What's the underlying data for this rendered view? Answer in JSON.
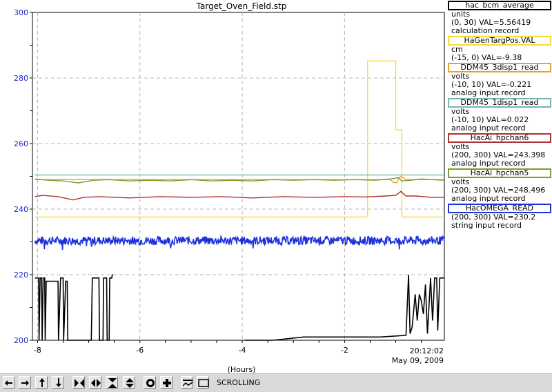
{
  "window": {
    "title": "Target_Oven_Field.stp"
  },
  "chart_data": {
    "type": "line",
    "title": "Target_Oven_Field.stp",
    "xlabel": "(Hours)",
    "ylabel": "",
    "xlim": [
      -8.1,
      -0.05
    ],
    "ylim": [
      200,
      300
    ],
    "x_ticks": [
      -8,
      -6,
      -4,
      -2
    ],
    "y_ticks": [
      200,
      220,
      240,
      260,
      280,
      300
    ],
    "grid": true,
    "end_time": "20:12:02",
    "end_date": "May 09, 2009",
    "series": [
      {
        "name": "hac_bcm_average",
        "color": "#000000",
        "units": "units",
        "range_val": "(0, 30) VAL=5.56419",
        "record": "calculation record",
        "points": [
          [
            -8.05,
            219
          ],
          [
            -7.98,
            219
          ],
          [
            -7.97,
            200
          ],
          [
            -7.95,
            219
          ],
          [
            -7.92,
            219
          ],
          [
            -7.91,
            200
          ],
          [
            -7.89,
            219
          ],
          [
            -7.86,
            219
          ],
          [
            -7.85,
            200
          ],
          [
            -7.83,
            218
          ],
          [
            -7.6,
            218
          ],
          [
            -7.59,
            200
          ],
          [
            -7.55,
            219
          ],
          [
            -7.5,
            219
          ],
          [
            -7.49,
            200
          ],
          [
            -7.45,
            218
          ],
          [
            -7.42,
            218
          ],
          [
            -7.41,
            200
          ],
          [
            -6.95,
            200
          ],
          [
            -6.93,
            219
          ],
          [
            -6.8,
            219
          ],
          [
            -6.79,
            200
          ],
          [
            -6.72,
            200
          ],
          [
            -6.71,
            219
          ],
          [
            -6.65,
            219
          ],
          [
            -6.64,
            200
          ],
          [
            -6.6,
            200
          ],
          [
            -6.59,
            219
          ],
          [
            -6.55,
            219
          ],
          [
            -6.54,
            220
          ],
          [
            -6.53,
            220
          ]
        ]
      },
      {
        "name": "hac_bcm_average",
        "color": "#000000",
        "units": "",
        "range_val": "",
        "record": "",
        "points": [
          [
            -3.95,
            200
          ],
          [
            -3.4,
            200
          ],
          [
            -2.8,
            201
          ],
          [
            -1.3,
            201
          ],
          [
            -0.8,
            201.5
          ],
          [
            -0.75,
            220
          ],
          [
            -0.72,
            202
          ],
          [
            -0.68,
            204
          ],
          [
            -0.62,
            214
          ],
          [
            -0.58,
            206
          ],
          [
            -0.54,
            214
          ],
          [
            -0.5,
            212
          ],
          [
            -0.46,
            208
          ],
          [
            -0.42,
            217
          ],
          [
            -0.38,
            202
          ],
          [
            -0.32,
            219
          ],
          [
            -0.28,
            206
          ],
          [
            -0.24,
            219
          ],
          [
            -0.2,
            219
          ],
          [
            -0.18,
            203
          ],
          [
            -0.14,
            219
          ],
          [
            -0.06,
            219
          ]
        ]
      },
      {
        "name": "HaGenTargPos.VAL",
        "color": "#f5dc3c",
        "units": "cm",
        "range_val": "(-15, 0) VAL=-9.38",
        "record": "",
        "points": [
          [
            -8.05,
            237.6
          ],
          [
            -1.55,
            237.6
          ],
          [
            -1.55,
            285.2
          ],
          [
            -1.0,
            285.2
          ],
          [
            -1.0,
            264.2
          ],
          [
            -0.88,
            264.2
          ],
          [
            -0.88,
            237.6
          ],
          [
            -0.05,
            237.6
          ]
        ]
      },
      {
        "name": "DDM45_3disp1_read",
        "color": "#f0a020",
        "units": "volts",
        "range_val": "(-10, 10) VAL=-0.221",
        "record": "analog input record",
        "points": [
          [
            -8.05,
            249.0
          ],
          [
            -7.0,
            249.0
          ],
          [
            -6.0,
            249.0
          ],
          [
            -4.0,
            249.0
          ],
          [
            -2.0,
            249.0
          ],
          [
            -1.1,
            249.0
          ],
          [
            -1.05,
            248.2
          ],
          [
            -0.98,
            248.0
          ],
          [
            -0.95,
            249.2
          ],
          [
            -0.9,
            250.0
          ],
          [
            -0.8,
            249.0
          ],
          [
            -0.05,
            249.0
          ]
        ]
      },
      {
        "name": "DDM45_1disp1_read",
        "color": "#78b4b4",
        "units": "volts",
        "range_val": "(-10, 10) VAL=0.022",
        "record": "analog input record",
        "points": [
          [
            -8.05,
            250.4
          ],
          [
            -0.05,
            250.4
          ]
        ]
      },
      {
        "name": "HacAi_hpchan6",
        "color": "#b03030",
        "units": "volts",
        "range_val": "(200, 300) VAL=243.398",
        "record": "analog input record",
        "points": [
          [
            -8.05,
            243.8
          ],
          [
            -7.9,
            244.2
          ],
          [
            -7.6,
            243.8
          ],
          [
            -7.3,
            242.8
          ],
          [
            -7.1,
            243.6
          ],
          [
            -6.8,
            243.8
          ],
          [
            -6.2,
            243.4
          ],
          [
            -5.6,
            243.8
          ],
          [
            -5.0,
            243.6
          ],
          [
            -4.4,
            243.8
          ],
          [
            -3.8,
            243.4
          ],
          [
            -3.2,
            243.8
          ],
          [
            -2.6,
            243.6
          ],
          [
            -2.0,
            243.8
          ],
          [
            -1.6,
            243.7
          ],
          [
            -1.2,
            244.0
          ],
          [
            -1.0,
            244.2
          ],
          [
            -0.9,
            245.4
          ],
          [
            -0.8,
            244.0
          ],
          [
            -0.6,
            244.0
          ],
          [
            -0.3,
            243.6
          ],
          [
            -0.05,
            243.6
          ]
        ]
      },
      {
        "name": "HacAi_hpchan5",
        "color": "#78a028",
        "units": "volts",
        "range_val": "(200, 300) VAL=248.496",
        "record": "analog input record",
        "points": [
          [
            -8.05,
            249.2
          ],
          [
            -7.8,
            248.8
          ],
          [
            -7.5,
            248.6
          ],
          [
            -7.2,
            248.0
          ],
          [
            -6.9,
            248.8
          ],
          [
            -6.6,
            249.0
          ],
          [
            -6.2,
            248.6
          ],
          [
            -5.8,
            248.8
          ],
          [
            -5.4,
            248.6
          ],
          [
            -5.0,
            249.0
          ],
          [
            -4.6,
            248.6
          ],
          [
            -4.2,
            248.8
          ],
          [
            -3.8,
            248.6
          ],
          [
            -3.4,
            249.0
          ],
          [
            -3.0,
            248.8
          ],
          [
            -2.6,
            249.0
          ],
          [
            -2.2,
            248.8
          ],
          [
            -1.8,
            249.0
          ],
          [
            -1.4,
            248.8
          ],
          [
            -1.1,
            249.2
          ],
          [
            -0.95,
            249.6
          ],
          [
            -0.88,
            248.6
          ],
          [
            -0.7,
            248.8
          ],
          [
            -0.5,
            249.2
          ],
          [
            -0.3,
            249.0
          ],
          [
            -0.05,
            248.8
          ]
        ]
      },
      {
        "name": "HacOMEGA_READ",
        "color": "#1e32dc",
        "units": "",
        "range_val": "(200, 300) VAL=230.2",
        "record": "string input record",
        "points": [],
        "noise": {
          "base": 230.4,
          "amplitude": 1.3,
          "x_start": -8.05,
          "x_end": -0.05,
          "samples": 700
        }
      }
    ]
  },
  "toolbar": {
    "status_label": "SCROLLING",
    "buttons": [
      {
        "name": "scroll-left-button",
        "icon": "arrow-left-icon"
      },
      {
        "name": "scroll-right-button",
        "icon": "arrow-right-icon"
      },
      {
        "name": "scroll-up-button",
        "icon": "arrow-up-icon"
      },
      {
        "name": "scroll-down-button",
        "icon": "arrow-down-icon"
      },
      {
        "name": "zoom-in-x-button",
        "icon": "zoom-in-x-icon"
      },
      {
        "name": "zoom-out-x-button",
        "icon": "zoom-out-x-icon"
      },
      {
        "name": "zoom-in-y-button",
        "icon": "zoom-in-y-icon"
      },
      {
        "name": "zoom-out-y-button",
        "icon": "zoom-out-y-icon"
      },
      {
        "name": "reset-button",
        "icon": "reset-icon"
      },
      {
        "name": "add-button",
        "icon": "plus-icon"
      },
      {
        "name": "autoscale-button",
        "icon": "autoscale-icon"
      },
      {
        "name": "style-button",
        "icon": "style-icon"
      }
    ]
  }
}
